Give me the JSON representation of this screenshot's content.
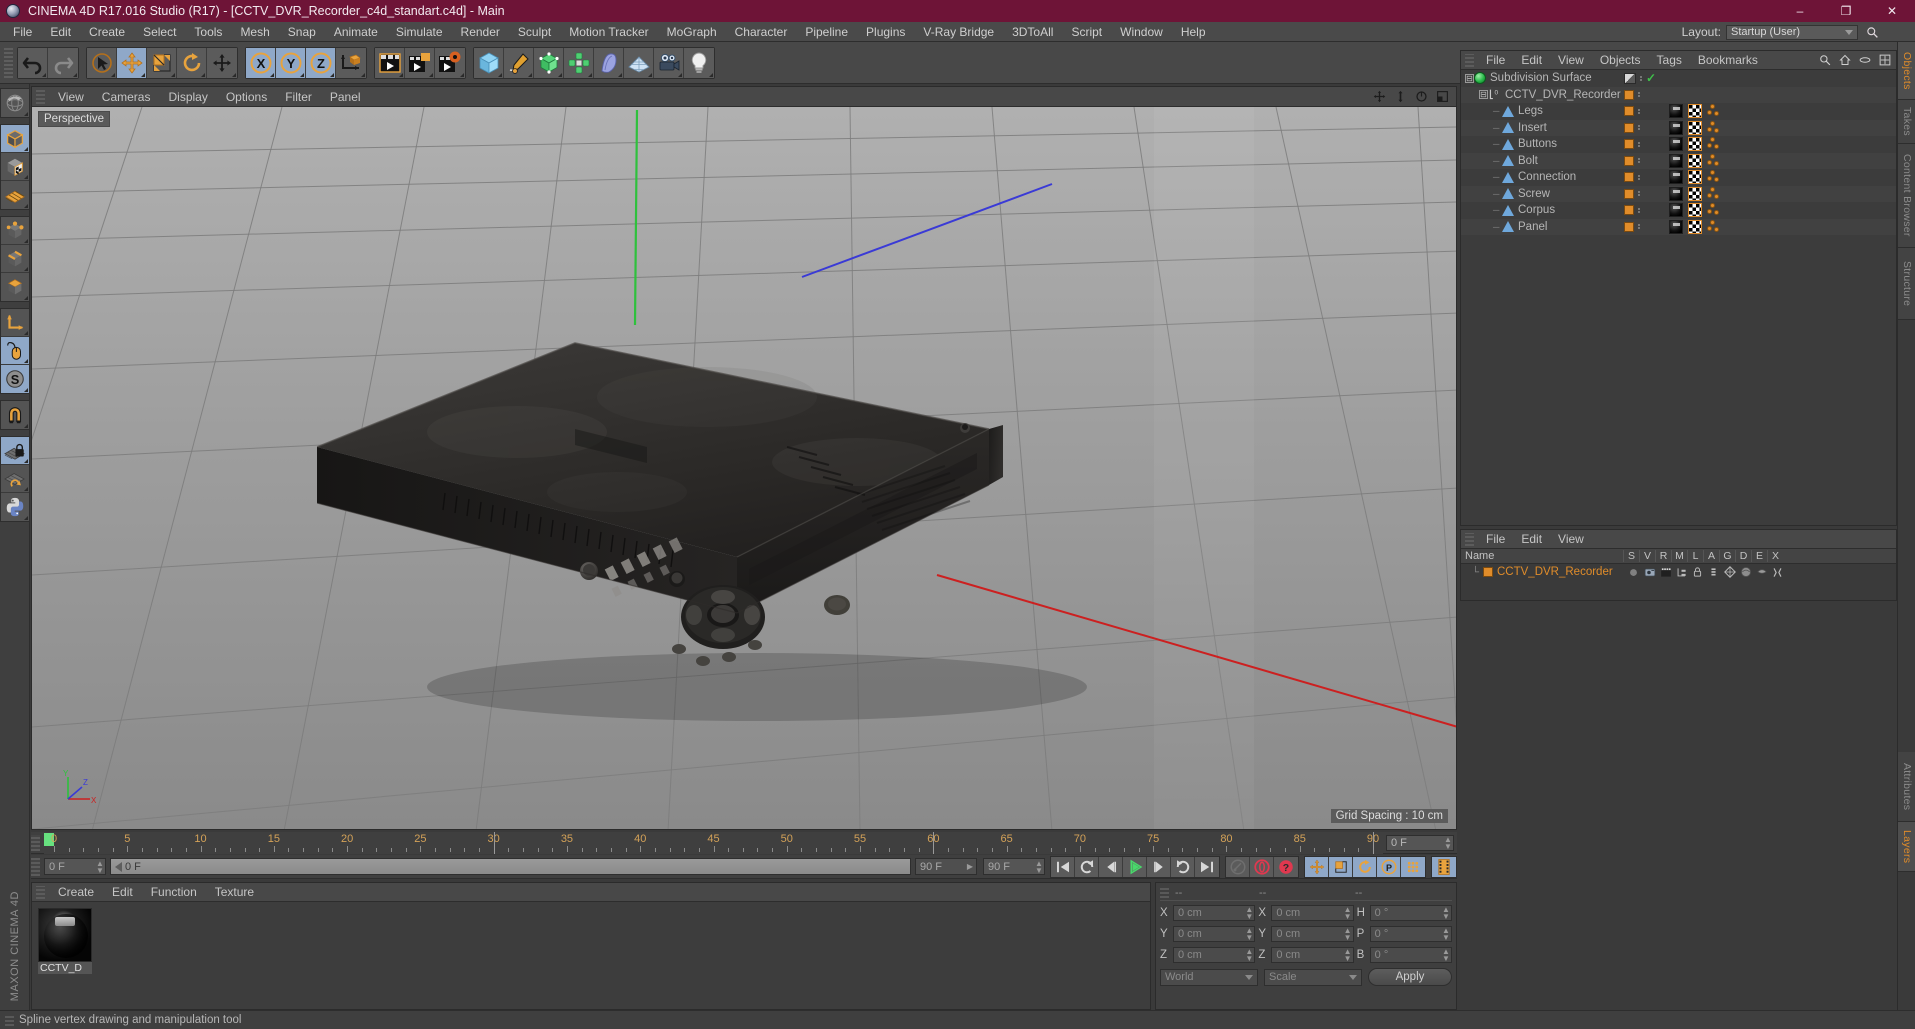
{
  "window": {
    "title": "CINEMA 4D R17.016 Studio (R17) - [CCTV_DVR_Recorder_c4d_standart.c4d] - Main",
    "minimize": "–",
    "maximize": "❐",
    "close": "✕",
    "titlebar_color": "#6e1437"
  },
  "menubar": {
    "items": [
      "File",
      "Edit",
      "Create",
      "Select",
      "Tools",
      "Mesh",
      "Snap",
      "Animate",
      "Simulate",
      "Render",
      "Sculpt",
      "Motion Tracker",
      "MoGraph",
      "Character",
      "Pipeline",
      "Plugins",
      "V-Ray Bridge",
      "3DToAll",
      "Script",
      "Window",
      "Help"
    ],
    "layout_label": "Layout:",
    "layout_value": "Startup (User)"
  },
  "toolbar": {
    "groups": [
      {
        "name": "history",
        "buttons": [
          {
            "icon": "undo-icon",
            "label": "Undo",
            "active": false
          },
          {
            "icon": "redo-icon",
            "label": "Redo",
            "active": false
          }
        ]
      },
      {
        "name": "transform",
        "buttons": [
          {
            "icon": "live-selection-icon",
            "label": "Live Selection",
            "active": false
          },
          {
            "icon": "move-icon",
            "label": "Move",
            "active": true
          },
          {
            "icon": "scale-icon",
            "label": "Scale",
            "active": false
          },
          {
            "icon": "rotate-icon",
            "label": "Rotate",
            "active": false
          },
          {
            "icon": "move-alt-icon",
            "label": "Move Tool",
            "active": false
          }
        ]
      },
      {
        "name": "axes",
        "buttons": [
          {
            "icon": "axis-x-icon",
            "label": "X",
            "active": true
          },
          {
            "icon": "axis-y-icon",
            "label": "Y",
            "active": true
          },
          {
            "icon": "axis-z-icon",
            "label": "Z",
            "active": true
          },
          {
            "icon": "world-coordinate-icon",
            "label": "World/Object",
            "active": false
          }
        ]
      },
      {
        "name": "render",
        "buttons": [
          {
            "icon": "render-view-icon",
            "label": "Render View",
            "active": false
          },
          {
            "icon": "render-picture-viewer-icon",
            "label": "Render to Picture Viewer",
            "active": false
          },
          {
            "icon": "render-settings-icon",
            "label": "Render Settings",
            "active": false
          }
        ]
      },
      {
        "name": "objects",
        "buttons": [
          {
            "icon": "cube-primitive-icon",
            "label": "Cube",
            "active": false
          },
          {
            "icon": "spline-pen-icon",
            "label": "Spline Pen",
            "active": false
          },
          {
            "icon": "subdivision-surface-icon",
            "label": "Subdivision Surface",
            "active": false
          },
          {
            "icon": "mograph-icon",
            "label": "MoGraph",
            "active": false
          },
          {
            "icon": "deformer-icon",
            "label": "Deformer",
            "active": false
          },
          {
            "icon": "scene-floor-icon",
            "label": "Scene",
            "active": false
          },
          {
            "icon": "camera-icon",
            "label": "Camera",
            "active": false
          },
          {
            "icon": "light-icon",
            "label": "Light",
            "active": false
          }
        ]
      }
    ]
  },
  "lefttools": {
    "vertical_label": "MAXON CINEMA 4D",
    "groups": [
      [
        {
          "icon": "world-axis-icon",
          "label": "Make Editable",
          "active": false
        }
      ],
      [
        {
          "icon": "model-mode-icon",
          "label": "Model Mode",
          "active": true
        },
        {
          "icon": "texture-mode-icon",
          "label": "Texture Mode",
          "active": false
        },
        {
          "icon": "workplane-icon",
          "label": "Workplane",
          "active": false
        }
      ],
      [
        {
          "icon": "points-mode-icon",
          "label": "Points",
          "active": false
        },
        {
          "icon": "edges-mode-icon",
          "label": "Edges",
          "active": false
        },
        {
          "icon": "polygons-mode-icon",
          "label": "Polygons",
          "active": false
        }
      ],
      [
        {
          "icon": "object-axis-icon",
          "label": "Enable Axis Modification",
          "active": false
        },
        {
          "icon": "viewport-solo-icon",
          "label": "Viewport Solo",
          "active": true
        },
        {
          "icon": "soft-selection-icon",
          "label": "Soft Interaction",
          "active": true
        }
      ],
      [
        {
          "icon": "magnet-icon",
          "label": "Magnet",
          "active": false
        }
      ],
      [
        {
          "icon": "lock-workplane-icon",
          "label": "Lock Workplane",
          "active": true
        },
        {
          "icon": "planar-workplane-icon",
          "label": "Planar Workplane",
          "active": false
        },
        {
          "icon": "python-icon",
          "label": "Python",
          "active": false
        }
      ]
    ]
  },
  "viewport": {
    "menu": [
      "View",
      "Cameras",
      "Display",
      "Options",
      "Filter",
      "Panel"
    ],
    "label": "Perspective",
    "grid_spacing": "Grid Spacing : 10 cm",
    "nav_icons": [
      "pan-icon",
      "dolly-icon",
      "rotate-view-icon",
      "maximize-view-icon"
    ],
    "axis_gizmo": {
      "x": "X",
      "y": "Y",
      "z": "Z"
    }
  },
  "timeline": {
    "ticks": [
      0,
      5,
      10,
      15,
      20,
      25,
      30,
      35,
      40,
      45,
      50,
      55,
      60,
      65,
      70,
      75,
      80,
      85,
      90
    ],
    "min_frame": 0,
    "max_frame": 90,
    "current_frame_field": "0 F",
    "end_frame_field": "90 F",
    "start_field": "0 F",
    "preview_end_field": "90 F",
    "scrub_value": "0 F",
    "transport_buttons": [
      {
        "icon": "go-to-start-icon",
        "label": "Go to Start",
        "active": false
      },
      {
        "icon": "step-back-keyframe-icon",
        "label": "Go to Previous Key",
        "active": false
      },
      {
        "icon": "step-back-frame-icon",
        "label": "Go to Previous Frame",
        "active": false
      },
      {
        "icon": "play-icon",
        "label": "Play Forwards",
        "active": false
      },
      {
        "icon": "step-forward-frame-icon",
        "label": "Go to Next Frame",
        "active": false
      },
      {
        "icon": "step-forward-keyframe-icon",
        "label": "Go to Next Key",
        "active": false
      },
      {
        "icon": "go-to-end-icon",
        "label": "Go to End",
        "active": false
      }
    ],
    "record_buttons": [
      {
        "icon": "autokey-icon",
        "label": "Autokeying",
        "active": false
      },
      {
        "icon": "record-icon",
        "label": "Record Active Objects",
        "active": false
      },
      {
        "icon": "keyframe-selection-icon",
        "label": "Keyframe Selection",
        "active": false
      }
    ],
    "key_toggle_buttons": [
      {
        "icon": "key-position-icon",
        "label": "Position",
        "active": true
      },
      {
        "icon": "key-scale-icon",
        "label": "Scale",
        "active": true
      },
      {
        "icon": "key-rotation-icon",
        "label": "Rotation",
        "active": true
      },
      {
        "icon": "key-param-icon",
        "label": "Parameter",
        "active": true
      },
      {
        "icon": "key-pla-icon",
        "label": "Point Level Animation",
        "active": true
      }
    ],
    "extra_button": {
      "icon": "timeline-strip-icon",
      "label": "Timeline",
      "active": true
    }
  },
  "material_manager": {
    "menu": [
      "Create",
      "Edit",
      "Function",
      "Texture"
    ],
    "materials": [
      {
        "name": "CCTV_D",
        "preview": "black-glossy-sphere"
      }
    ]
  },
  "coordinate_manager": {
    "headers": [
      "--",
      "--",
      "--"
    ],
    "rows": [
      {
        "pos_label": "X",
        "pos_value": "0 cm",
        "size_label": "X",
        "size_value": "0 cm",
        "rot_label": "H",
        "rot_value": "0 °"
      },
      {
        "pos_label": "Y",
        "pos_value": "0 cm",
        "size_label": "Y",
        "size_value": "0 cm",
        "rot_label": "P",
        "rot_value": "0 °"
      },
      {
        "pos_label": "Z",
        "pos_value": "0 cm",
        "size_label": "Z",
        "size_value": "0 cm",
        "rot_label": "B",
        "rot_value": "0 °"
      }
    ],
    "space_select": "World",
    "mode_select": "Scale",
    "apply_label": "Apply"
  },
  "object_manager": {
    "menu": [
      "File",
      "Edit",
      "View",
      "Objects",
      "Tags",
      "Bookmarks"
    ],
    "header_icons": [
      "search-icon",
      "home-icon",
      "ellipse-icon",
      "add-layout-icon"
    ],
    "tree": [
      {
        "name": "Subdivision Surface",
        "depth": 0,
        "icon": "subdivision-surface-icon",
        "expandable": true,
        "visibility_dots": true,
        "tags": [],
        "enabled_check": true,
        "half_square": true
      },
      {
        "name": "CCTV_DVR_Recorder",
        "depth": 1,
        "icon": "null-object-icon",
        "expandable": true,
        "visibility_dots": true,
        "tags": [],
        "enabled_check": false,
        "half_square": false
      },
      {
        "name": "Legs",
        "depth": 2,
        "icon": "polygon-object-icon",
        "expandable": false,
        "visibility_dots": true,
        "tags": [
          "material-tag",
          "uv-tag",
          "selection-tag"
        ]
      },
      {
        "name": "Insert",
        "depth": 2,
        "icon": "polygon-object-icon",
        "expandable": false,
        "visibility_dots": true,
        "tags": [
          "material-tag",
          "uv-tag",
          "selection-tag"
        ]
      },
      {
        "name": "Buttons",
        "depth": 2,
        "icon": "polygon-object-icon",
        "expandable": false,
        "visibility_dots": true,
        "tags": [
          "material-tag",
          "uv-tag",
          "selection-tag"
        ]
      },
      {
        "name": "Bolt",
        "depth": 2,
        "icon": "polygon-object-icon",
        "expandable": false,
        "visibility_dots": true,
        "tags": [
          "material-tag",
          "uv-tag",
          "selection-tag"
        ]
      },
      {
        "name": "Connection",
        "depth": 2,
        "icon": "polygon-object-icon",
        "expandable": false,
        "visibility_dots": true,
        "tags": [
          "material-tag",
          "uv-tag",
          "selection-tag"
        ]
      },
      {
        "name": "Screw",
        "depth": 2,
        "icon": "polygon-object-icon",
        "expandable": false,
        "visibility_dots": true,
        "tags": [
          "material-tag",
          "uv-tag",
          "selection-tag"
        ]
      },
      {
        "name": "Corpus",
        "depth": 2,
        "icon": "polygon-object-icon",
        "expandable": false,
        "visibility_dots": true,
        "tags": [
          "material-tag",
          "uv-tag",
          "selection-tag"
        ]
      },
      {
        "name": "Panel",
        "depth": 2,
        "icon": "polygon-object-icon",
        "expandable": false,
        "visibility_dots": true,
        "tags": [
          "material-tag",
          "uv-tag",
          "selection-tag"
        ]
      }
    ]
  },
  "layer_manager": {
    "menu": [
      "File",
      "Edit",
      "View"
    ],
    "columns": [
      "Name",
      "S",
      "V",
      "R",
      "M",
      "L",
      "A",
      "G",
      "D",
      "E",
      "X"
    ],
    "rows": [
      {
        "name": "CCTV_DVR_Recorder",
        "color": "#e08c2a",
        "icons": [
          "solo-dot-icon",
          "visible-icon",
          "render-icon",
          "manager-icon",
          "lock-icon",
          "animation-icon",
          "generator-icon",
          "deformer-icon",
          "expression-icon",
          "xref-icon"
        ]
      }
    ]
  },
  "right_tabs": {
    "upper": [
      {
        "label": "Objects",
        "active": true
      },
      {
        "label": "Takes",
        "active": false
      },
      {
        "label": "Content Browser",
        "active": false
      },
      {
        "label": "Structure",
        "active": false
      }
    ],
    "lower": [
      {
        "label": "Attributes",
        "active": false
      },
      {
        "label": "Layers",
        "active": true
      }
    ]
  },
  "statusbar": {
    "text": "Spline vertex drawing and manipulation tool"
  }
}
